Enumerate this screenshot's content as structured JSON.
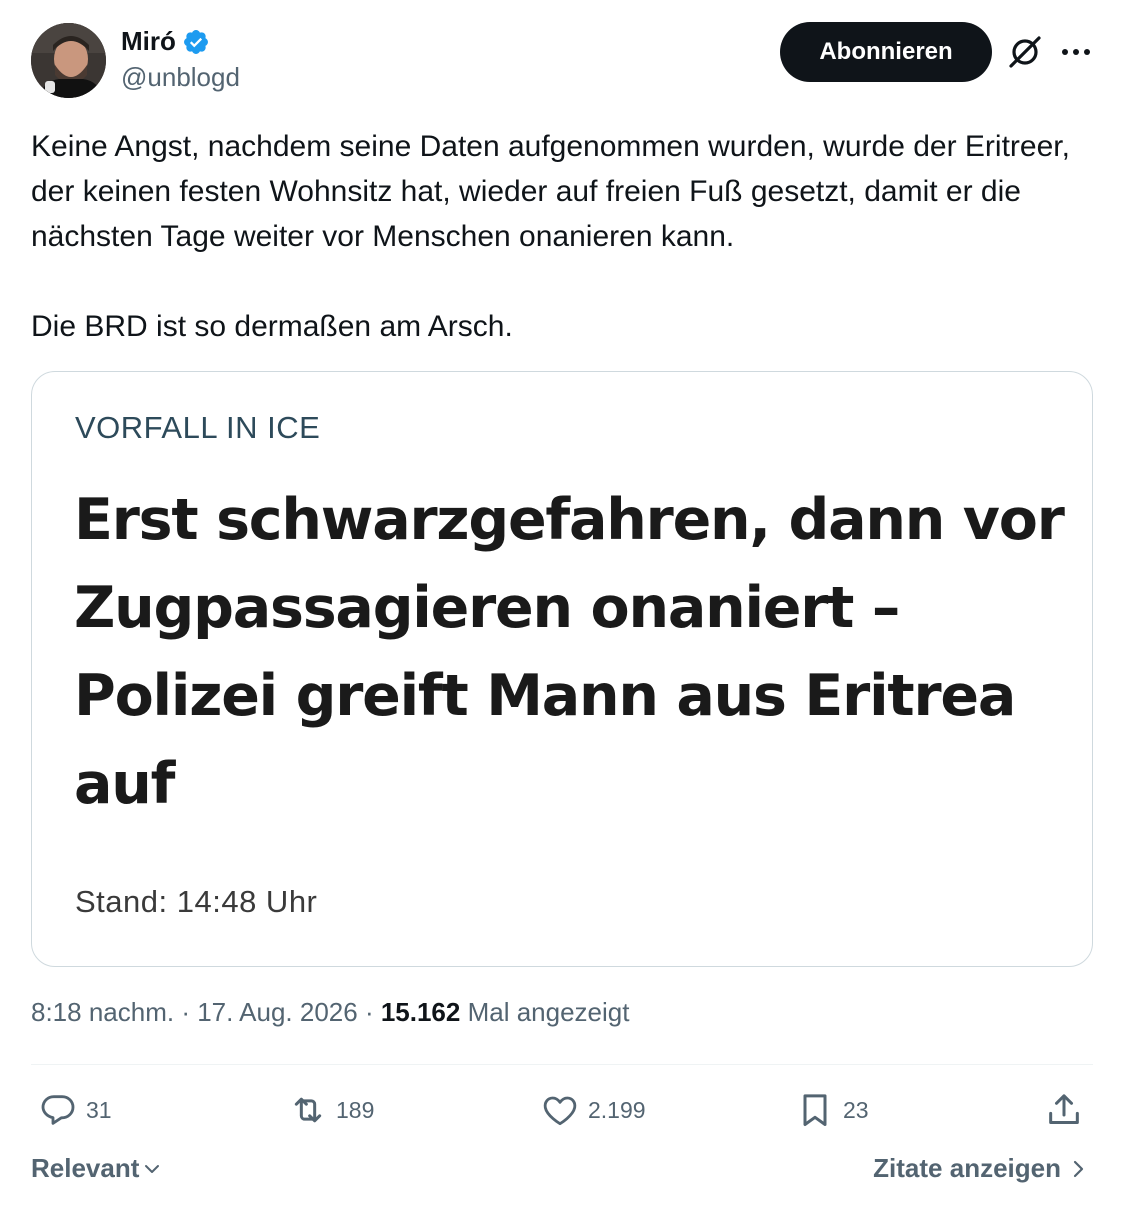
{
  "author": {
    "display_name": "Miró",
    "handle": "@unblogd",
    "verified": true
  },
  "header": {
    "follow_label": "Abonnieren",
    "icons": [
      "grok-icon",
      "more-icon"
    ]
  },
  "tweet": {
    "text": "Keine Angst, nachdem seine Daten aufgenommen wurden, wurde der Eritreer, der keinen festen Wohnsitz hat, wieder auf freien Fuß gesetzt, damit er die nächsten Tage weiter vor Menschen onanieren kann.\n\nDie BRD ist so dermaßen am Arsch."
  },
  "card": {
    "kicker": "VORFALL IN ICE",
    "headline": "Erst schwarzgefahren, dann vor Zugpassagieren onaniert – Polizei greift Mann aus Eritrea auf",
    "stand": "Stand: 14:48 Uhr"
  },
  "meta": {
    "time": "8:18 nachm.",
    "date": "17. Aug. 2026",
    "views_count": "15.162",
    "views_label": "Mal angezeigt"
  },
  "actions": {
    "replies": "31",
    "retweets": "189",
    "likes": "2.199",
    "bookmarks": "23"
  },
  "footer": {
    "sort_label": "Relevant",
    "quotes_label": "Zitate anzeigen"
  },
  "colors": {
    "text_primary": "#0f1419",
    "text_secondary": "#536471",
    "verified_blue": "#1d9bf0",
    "border": "#cfd9de"
  }
}
